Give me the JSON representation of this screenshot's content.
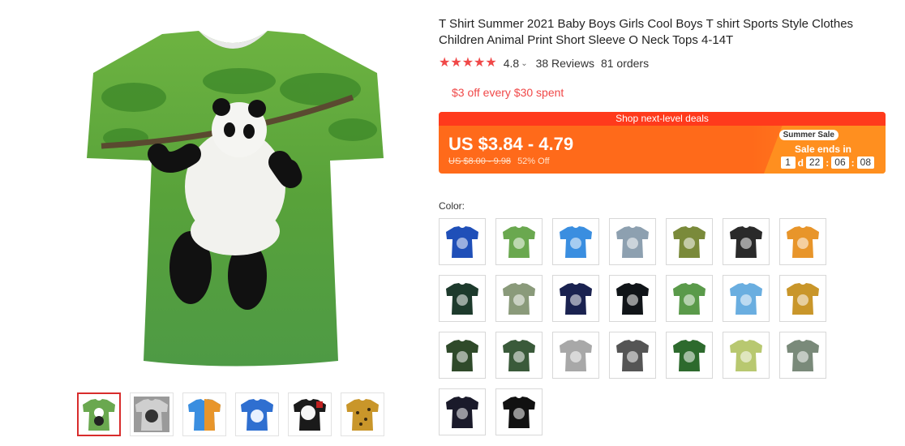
{
  "product": {
    "title": "T Shirt Summer 2021 Baby Boys Girls Cool Boys T shirt Sports Style Clothes Children Animal Print Short Sleeve O Neck Tops 4-14T"
  },
  "rating": {
    "stars": "★★★★★",
    "value": "4.8",
    "chevron": "⌄",
    "reviews": "38 Reviews",
    "orders": "81 orders"
  },
  "coupon": "$3 off every $30 spent",
  "deal": {
    "banner": "Shop next-level deals",
    "price": "US $3.84 - 4.79",
    "old_price": "US $8.00 - 9.98",
    "discount": "52% Off",
    "badge": "Summer Sale",
    "ends_label": "Sale ends in",
    "countdown": {
      "days": "1",
      "d": "d",
      "hours": "22",
      "sep": ":",
      "minutes": "06",
      "seconds": "08"
    },
    "colors": {
      "bar": "#ff6a1a",
      "banner": "#ff3a1c",
      "accent": "#f04848"
    }
  },
  "color_section": {
    "label": "Color:"
  },
  "thumbnails": [
    {
      "icon": "panda-tshirt-icon",
      "color": "#6aa84f"
    },
    {
      "icon": "panda-gray-tshirt-icon",
      "color": "#9a9a9a"
    },
    {
      "icon": "fire-ice-tshirt-icon",
      "color": "#3a8ee0"
    },
    {
      "icon": "wolf-blue-tshirt-icon",
      "color": "#2f6fd0"
    },
    {
      "icon": "wolf-white-tshirt-icon",
      "color": "#1a1a1a"
    },
    {
      "icon": "leopard-tshirt-icon",
      "color": "#c9962a"
    }
  ],
  "swatches": [
    {
      "icon": "blue-galaxy-tshirt-icon",
      "color": "#1f4fb8"
    },
    {
      "icon": "panda-green-tshirt-icon",
      "color": "#6aa84f"
    },
    {
      "icon": "wolf-blue-tshirt-icon",
      "color": "#3a8ee0"
    },
    {
      "icon": "mountain-tshirt-icon",
      "color": "#8da0b0"
    },
    {
      "icon": "panda-tree-tshirt-icon",
      "color": "#7a8a3a"
    },
    {
      "icon": "white-wolf-tshirt-icon",
      "color": "#2a2a2a"
    },
    {
      "icon": "fire-ice-tshirt-icon",
      "color": "#e8952a"
    },
    {
      "icon": "dark-wolf-tshirt-icon",
      "color": "#1d3a2c"
    },
    {
      "icon": "panda-sit-tshirt-icon",
      "color": "#8a9a7a"
    },
    {
      "icon": "moon-wolf-tshirt-icon",
      "color": "#1a2250"
    },
    {
      "icon": "neon-wolf-tshirt-icon",
      "color": "#101418"
    },
    {
      "icon": "panda-bamboo-tshirt-icon",
      "color": "#5a9a4a"
    },
    {
      "icon": "sky-wolf-tshirt-icon",
      "color": "#6aaee0"
    },
    {
      "icon": "leopard-tshirt-icon",
      "color": "#c9962a"
    },
    {
      "icon": "panda-dark-tshirt-icon",
      "color": "#2f4a2a"
    },
    {
      "icon": "panda-forest-tshirt-icon",
      "color": "#3a5a3a"
    },
    {
      "icon": "panda-gray-tshirt-icon",
      "color": "#a8a8a8"
    },
    {
      "icon": "gray-wolf-tshirt-icon",
      "color": "#555555"
    },
    {
      "icon": "panda-grass-tshirt-icon",
      "color": "#2d6a2d"
    },
    {
      "icon": "panda-light-tshirt-icon",
      "color": "#b8c870"
    },
    {
      "icon": "panda-leaf-tshirt-icon",
      "color": "#7a8a7a"
    },
    {
      "icon": "night-wolf-tshirt-icon",
      "color": "#1a1a2a"
    },
    {
      "icon": "black-wolf-tshirt-icon",
      "color": "#111111"
    }
  ]
}
